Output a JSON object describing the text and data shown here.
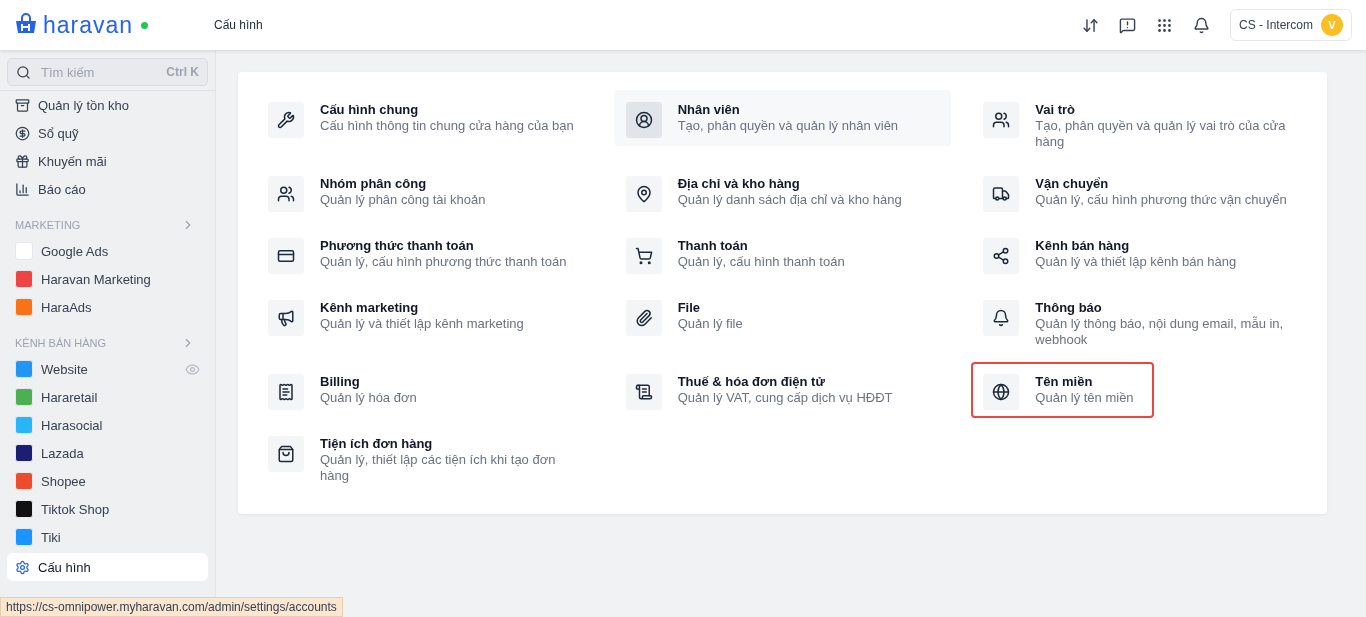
{
  "header": {
    "brand": "haravan",
    "online": true,
    "page_title": "Cấu hình",
    "account": {
      "name": "CS - Intercom",
      "avatar": "V"
    }
  },
  "sidebar": {
    "search": {
      "placeholder": "Tìm kiếm",
      "shortcut": "Ctrl K"
    },
    "items": [
      {
        "label": "Quản lý tồn kho",
        "selected": false
      },
      {
        "label": "Sổ quỹ",
        "selected": false
      },
      {
        "label": "Khuyến mãi",
        "selected": false
      },
      {
        "label": "Báo cáo",
        "selected": false
      }
    ],
    "sections": [
      {
        "title": "MARKETING",
        "items": [
          {
            "label": "Google Ads",
            "color": "#ffffff"
          },
          {
            "label": "Haravan Marketing",
            "color": "#ef4444"
          },
          {
            "label": "HaraAds",
            "color": "#f97316"
          }
        ]
      },
      {
        "title": "KÊNH BÁN HÀNG",
        "items": [
          {
            "label": "Website",
            "color": "#2196f3",
            "visible": true
          },
          {
            "label": "Hararetail",
            "color": "#4caf50"
          },
          {
            "label": "Harasocial",
            "color": "#29b6f6"
          },
          {
            "label": "Lazada",
            "color": "#1a1f71"
          },
          {
            "label": "Shopee",
            "color": "#ee4d2d"
          },
          {
            "label": "Tiktok Shop",
            "color": "#111111"
          },
          {
            "label": "Tiki",
            "color": "#1a94ff"
          }
        ]
      }
    ],
    "footer_item": {
      "label": "Cấu hình",
      "selected": true
    }
  },
  "settings": [
    {
      "title": "Cấu hình chung",
      "description": "Cấu hình thông tin chung cửa hàng của bạn",
      "hovered": false,
      "outlined": false
    },
    {
      "title": "Nhân viên",
      "description": "Tạo, phân quyền và quản lý nhân viên",
      "hovered": true,
      "outlined": false
    },
    {
      "title": "Vai trò",
      "description": "Tạo, phân quyền và quản lý vai trò của cửa hàng",
      "hovered": false,
      "outlined": false
    },
    {
      "title": "Nhóm phân công",
      "description": "Quản lý phân công tài khoản",
      "hovered": false,
      "outlined": false
    },
    {
      "title": "Địa chỉ và kho hàng",
      "description": "Quản lý danh sách địa chỉ và kho hàng",
      "hovered": false,
      "outlined": false
    },
    {
      "title": "Vận chuyển",
      "description": "Quản lý, cấu hình phương thức vận chuyển",
      "hovered": false,
      "outlined": false
    },
    {
      "title": "Phương thức thanh toán",
      "description": "Quản lý, cấu hình phương thức thanh toán",
      "hovered": false,
      "outlined": false
    },
    {
      "title": "Thanh toán",
      "description": "Quản lý, cấu hình thanh toán",
      "hovered": false,
      "outlined": false
    },
    {
      "title": "Kênh bán hàng",
      "description": "Quản lý và thiết lập kênh bán hàng",
      "hovered": false,
      "outlined": false
    },
    {
      "title": "Kênh marketing",
      "description": "Quản lý và thiết lập kênh marketing",
      "hovered": false,
      "outlined": false
    },
    {
      "title": "File",
      "description": "Quản lý file",
      "hovered": false,
      "outlined": false
    },
    {
      "title": "Thông báo",
      "description": "Quản lý thông báo, nội dung email, mẫu in, webhook",
      "hovered": false,
      "outlined": false
    },
    {
      "title": "Billing",
      "description": "Quản lý hóa đơn",
      "hovered": false,
      "outlined": false
    },
    {
      "title": "Thuế & hóa đơn điện tử",
      "description": "Quản lý VAT, cung cấp dịch vụ HĐĐT",
      "hovered": false,
      "outlined": false
    },
    {
      "title": "Tên miền",
      "description": "Quản lý tên miền",
      "hovered": false,
      "outlined": true
    },
    {
      "title": "Tiện ích đơn hàng",
      "description": "Quản lý, thiết lập các tiện ích khi tạo đơn hàng",
      "hovered": false,
      "outlined": false
    }
  ],
  "status_url": "https://cs-omnipower.myharavan.com/admin/settings/accounts"
}
